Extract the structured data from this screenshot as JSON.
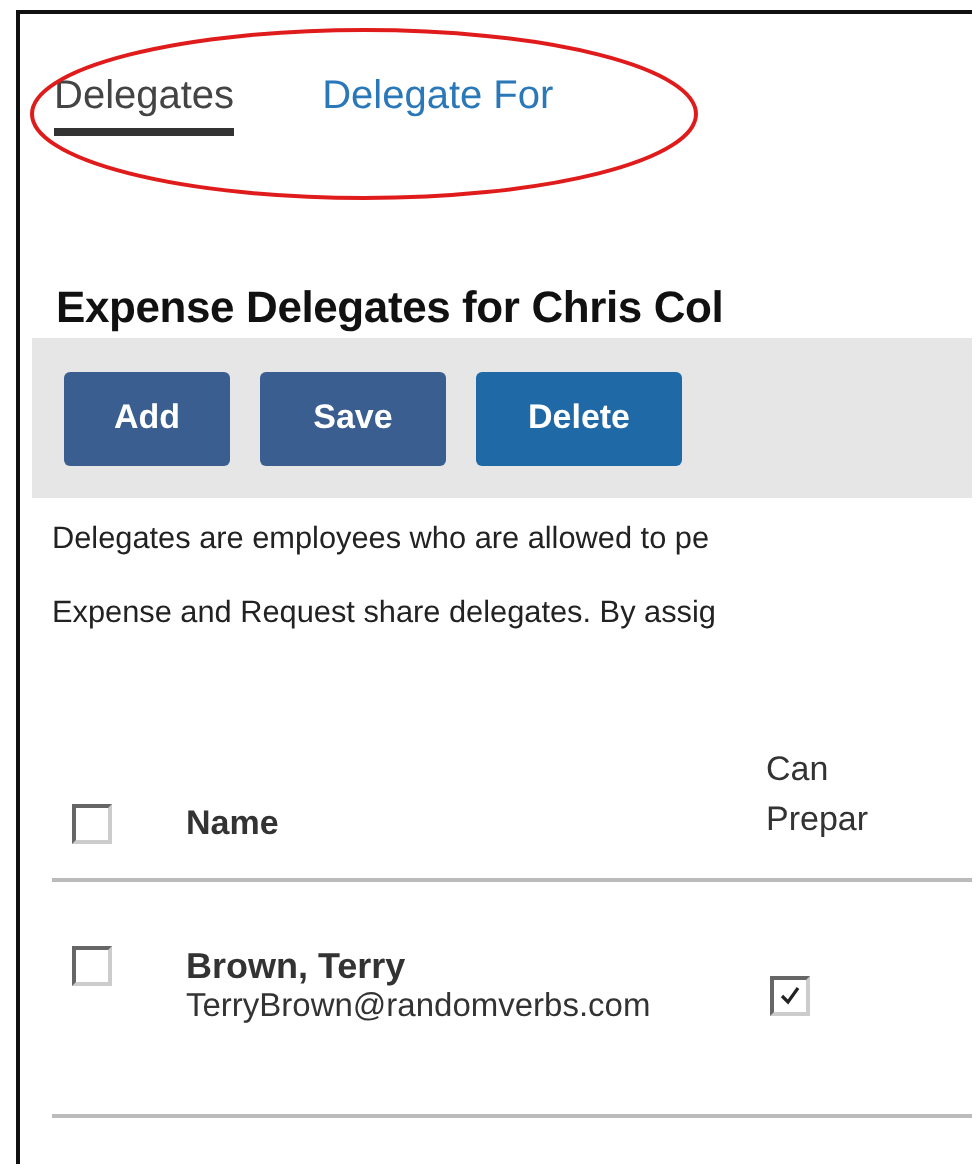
{
  "tabs": [
    {
      "label": "Delegates",
      "selected": true
    },
    {
      "label": "Delegate For",
      "selected": false
    }
  ],
  "heading": "Expense Delegates for Chris Col",
  "toolbar": {
    "buttons": [
      {
        "label": "Add",
        "kind": "dark"
      },
      {
        "label": "Save",
        "kind": "dark"
      },
      {
        "label": "Delete",
        "kind": "primary"
      }
    ]
  },
  "description": [
    "Delegates are employees who are allowed to pe",
    "Expense and Request share delegates. By assig"
  ],
  "table": {
    "header": {
      "checked": false,
      "columns": [
        "Name",
        "Can Prepar"
      ]
    },
    "rows": [
      {
        "checked": false,
        "name": "Brown, Terry",
        "email": "TerryBrown@randomverbs.com",
        "can_prepare": true
      }
    ]
  }
}
